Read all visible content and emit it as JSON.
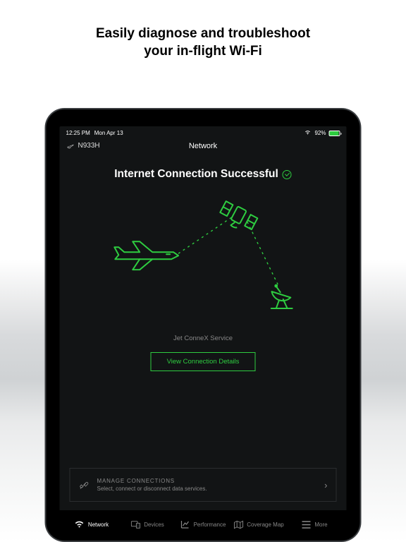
{
  "hero": {
    "line1": "Easily diagnose and troubleshoot",
    "line2": "your in-flight Wi-Fi"
  },
  "status": {
    "time": "12:25 PM",
    "date": "Mon Apr 13",
    "battery": "92%"
  },
  "header": {
    "tail": "N933H",
    "title": "Network"
  },
  "heading": "Internet Connection Successful",
  "service": "Jet ConneX Service",
  "button": "View Connection Details",
  "manage": {
    "title": "MANAGE CONNECTIONS",
    "sub": "Select, connect or disconnect data services."
  },
  "tabs": [
    "Network",
    "Devices",
    "Performance",
    "Coverage Map",
    "More"
  ]
}
